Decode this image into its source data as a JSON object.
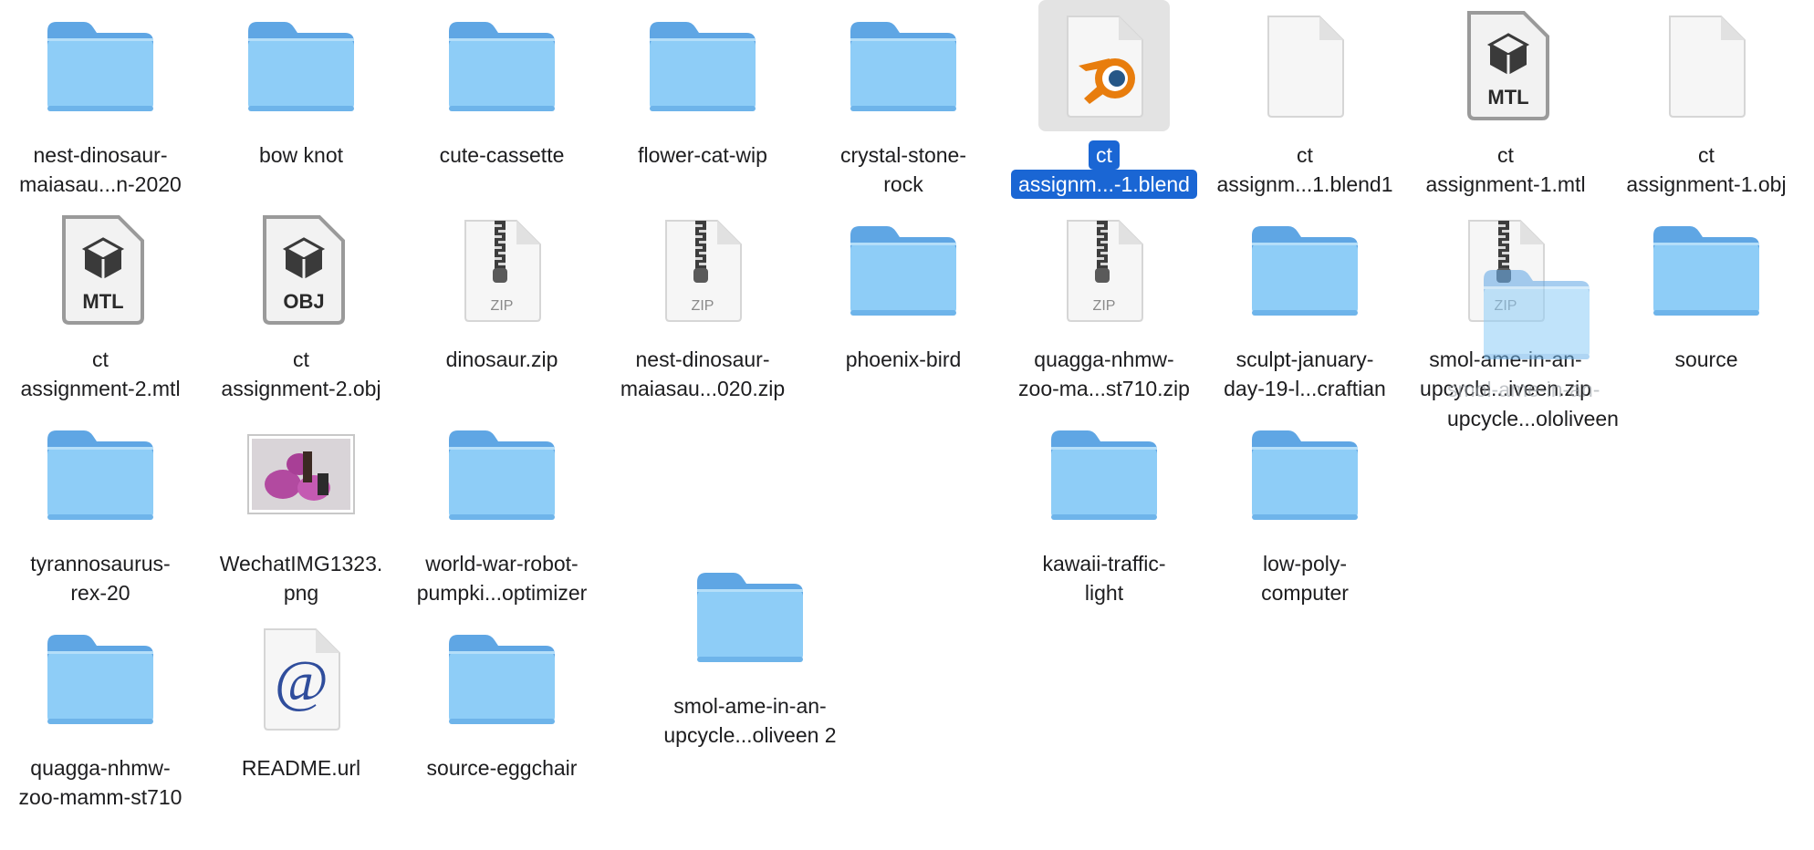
{
  "finder": {
    "items": [
      {
        "name": "nest-dinosaur-maiasau...n-2020",
        "lines": [
          "nest-dinosaur-",
          "maiasau...n-2020"
        ],
        "kind": "folder"
      },
      {
        "name": "bow knot",
        "lines": [
          "bow knot"
        ],
        "kind": "folder"
      },
      {
        "name": "cute-cassette",
        "lines": [
          "cute-cassette"
        ],
        "kind": "folder"
      },
      {
        "name": "flower-cat-wip",
        "lines": [
          "flower-cat-wip"
        ],
        "kind": "folder"
      },
      {
        "name": "crystal-stone-rock",
        "lines": [
          "crystal-stone-",
          "rock"
        ],
        "kind": "folder"
      },
      {
        "name": "ct assignm...-1.blend",
        "lines": [
          "ct",
          "assignm...-1.blend"
        ],
        "kind": "blend",
        "selected": true
      },
      {
        "name": "ct assignm...1.blend1",
        "lines": [
          "ct",
          "assignm...1.blend1"
        ],
        "kind": "doc"
      },
      {
        "name": "ct assignment-1.mtl",
        "lines": [
          "ct",
          "assignment-1.mtl"
        ],
        "kind": "mtl",
        "badge": "MTL"
      },
      {
        "name": "ct assignment-1.obj",
        "lines": [
          "ct",
          "assignment-1.obj"
        ],
        "kind": "doc"
      },
      {
        "name": "ct assignment-2.mtl",
        "lines": [
          "ct",
          "assignment-2.mtl"
        ],
        "kind": "mtl",
        "badge": "MTL"
      },
      {
        "name": "ct assignment-2.obj",
        "lines": [
          "ct",
          "assignment-2.obj"
        ],
        "kind": "mtl",
        "badge": "OBJ"
      },
      {
        "name": "dinosaur.zip",
        "lines": [
          "dinosaur.zip"
        ],
        "kind": "zip",
        "badge": "ZIP"
      },
      {
        "name": "nest-dinosaur-maiasau...020.zip",
        "lines": [
          "nest-dinosaur-",
          "maiasau...020.zip"
        ],
        "kind": "zip",
        "badge": "ZIP"
      },
      {
        "name": "phoenix-bird",
        "lines": [
          "phoenix-bird"
        ],
        "kind": "folder"
      },
      {
        "name": "quagga-nhmw-zoo-ma...st710.zip",
        "lines": [
          "quagga-nhmw-",
          "zoo-ma...st710.zip"
        ],
        "kind": "zip",
        "badge": "ZIP"
      },
      {
        "name": "sculpt-january-day-19-l...craftian",
        "lines": [
          "sculpt-january-",
          "day-19-l...craftian"
        ],
        "kind": "folder"
      },
      {
        "name": "smol-ame-in-an-upcycle...iveen.zip",
        "lines": [
          "smol-ame-in-an-",
          "upcycle...iveen.zip"
        ],
        "kind": "zip",
        "badge": "ZIP"
      },
      {
        "name": "source",
        "lines": [
          "source"
        ],
        "kind": "folder"
      },
      {
        "name": "tyrannosaurus-rex-20",
        "lines": [
          "tyrannosaurus-",
          "rex-20"
        ],
        "kind": "folder"
      },
      {
        "name": "WechatIMG1323.png",
        "lines": [
          "WechatIMG1323.",
          "png"
        ],
        "kind": "image"
      },
      {
        "name": "world-war-robot-pumpki...optimizer",
        "lines": [
          "world-war-robot-",
          "pumpki...optimizer"
        ],
        "kind": "folder"
      },
      {
        "name": "kawaii-traffic-light",
        "lines": [
          "kawaii-traffic-",
          "light"
        ],
        "kind": "folder"
      },
      {
        "name": "low-poly-computer",
        "lines": [
          "low-poly-",
          "computer"
        ],
        "kind": "folder"
      },
      {
        "name": "quagga-nhmw-zoo-mamm-st710",
        "lines": [
          "quagga-nhmw-",
          "zoo-mamm-st710"
        ],
        "kind": "folder"
      },
      {
        "name": "README.url",
        "lines": [
          "README.url"
        ],
        "kind": "url",
        "badge": "@"
      },
      {
        "name": "source-eggchair",
        "lines": [
          "source-eggchair"
        ],
        "kind": "folder"
      },
      {
        "name": "smol-ame-in-an-upcycle...oliveen 2",
        "lines": [
          "smol-ame-in-an-",
          "upcycle...oliveen 2"
        ],
        "kind": "folder"
      }
    ],
    "drag_ghost_label": [
      "smol-ame-in-an-",
      "upcycle...ololiveen"
    ]
  },
  "colors": {
    "folder_front": "#8ecdf7",
    "folder_back": "#5fa6e4",
    "selection": "#1a66d4"
  }
}
